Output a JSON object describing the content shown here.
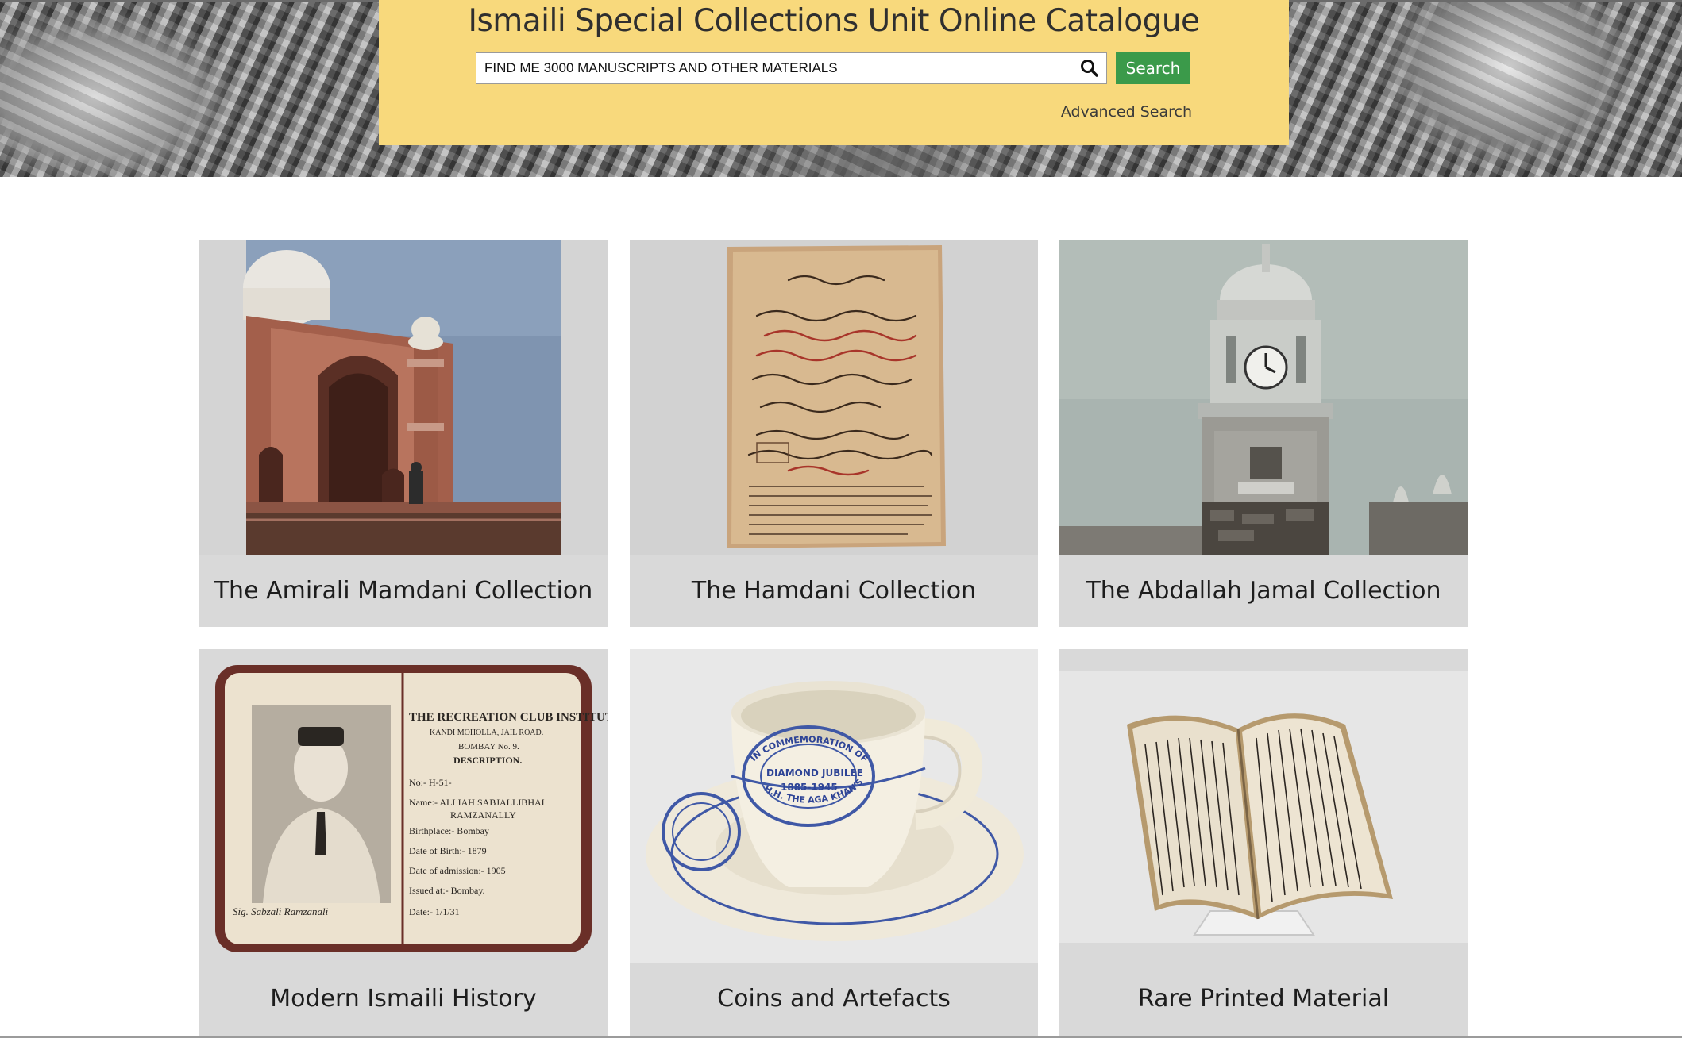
{
  "header": {
    "title": "Ismaili Special Collections Unit Online Catalogue",
    "search": {
      "value": "FIND ME 3000 MANUSCRIPTS AND OTHER MATERIALS",
      "icon": "search-icon"
    },
    "search_button_label": "Search",
    "advanced_search_label": "Advanced Search",
    "colors": {
      "panel": "#f8d97c",
      "button": "#3b9a4a"
    }
  },
  "collections": [
    {
      "label": "The Amirali Mamdani Collection",
      "image": "mosque-photo"
    },
    {
      "label": "The Hamdani Collection",
      "image": "manuscript-page"
    },
    {
      "label": "The Abdallah Jamal Collection",
      "image": "clock-tower-photo"
    },
    {
      "label": "Modern Ismaili History",
      "image": "membership-card"
    },
    {
      "label": "Coins and Artefacts",
      "image": "commemorative-cup"
    },
    {
      "label": "Rare Printed Material",
      "image": "printed-book"
    }
  ],
  "card": {
    "club": "THE RECREATION CLUB INSTITUTE.",
    "address": "KANDI MOHOLLA, JAIL ROAD.",
    "city": "BOMBAY No. 9.",
    "heading": "DESCRIPTION.",
    "no": "No:- H-51-",
    "name_line1": "Name:- ALLIAH SABJALLIBHAI",
    "name_line2": "RAMZANALLY",
    "birthplace": "Birthplace:- Bombay",
    "dob": "Date of Birth:- 1879",
    "admission": "Date of admission:- 1905",
    "issued": "Issued at:- Bombay.",
    "date": "Date:- 1/1/31",
    "sig": "Sig. Sabzali Ramzanali"
  },
  "cup": {
    "line1": "IN COMMEMORATION OF",
    "line2": "DIAMOND JUBILEE",
    "line3": "1885-1945",
    "line4": "H.H. THE AGA KHAN'S"
  }
}
